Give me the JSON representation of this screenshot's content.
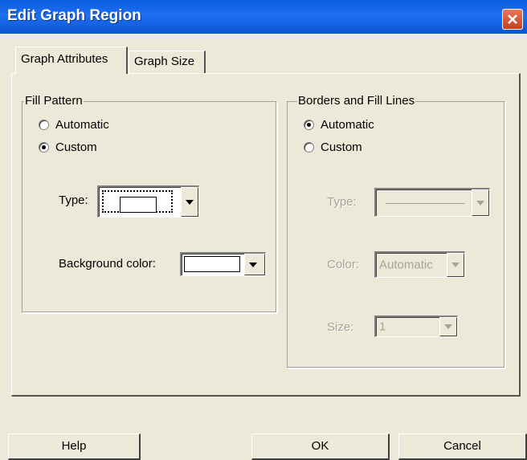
{
  "window": {
    "title": "Edit Graph Region"
  },
  "tabs": [
    {
      "label": "Graph Attributes",
      "active": true
    },
    {
      "label": "Graph Size",
      "active": false
    }
  ],
  "fill_pattern": {
    "legend": "Fill Pattern",
    "options": [
      {
        "label": "Automatic",
        "checked": false
      },
      {
        "label": "Custom",
        "checked": true
      }
    ],
    "type_label": "Type:",
    "background_label": "Background color:"
  },
  "borders": {
    "legend": "Borders and Fill Lines",
    "options": [
      {
        "label": "Automatic",
        "checked": true
      },
      {
        "label": "Custom",
        "checked": false
      }
    ],
    "type_label": "Type:",
    "color_label": "Color:",
    "color_value": "Automatic",
    "size_label": "Size:",
    "size_value": "1"
  },
  "buttons": {
    "help": "Help",
    "ok": "OK",
    "cancel": "Cancel"
  }
}
